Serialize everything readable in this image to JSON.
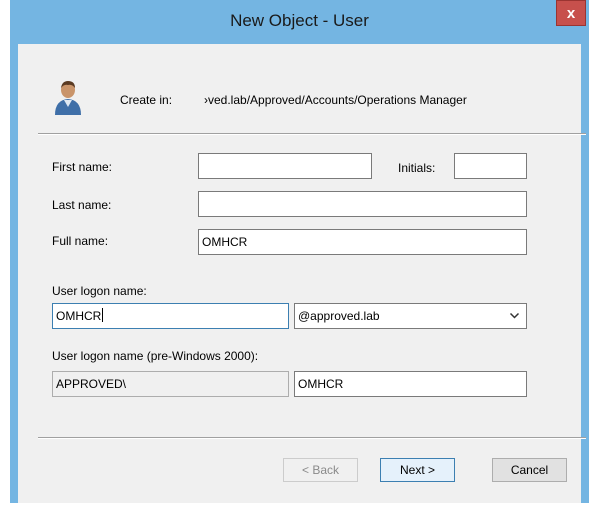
{
  "window": {
    "title": "New Object - User",
    "close_label": "x"
  },
  "create_in": {
    "label": "Create in:",
    "path": "›ved.lab/Approved/Accounts/Operations Manager",
    "icon": "user-icon"
  },
  "fields": {
    "first_name": {
      "label": "First name:",
      "value": ""
    },
    "initials": {
      "label": "Initials:",
      "value": ""
    },
    "last_name": {
      "label": "Last name:",
      "value": ""
    },
    "full_name": {
      "label": "Full name:",
      "value": "OMHCR"
    },
    "logon_name": {
      "label": "User logon name:",
      "value": "OMHCR"
    },
    "domain": {
      "selected": "@approved.lab"
    },
    "pre2000": {
      "label": "User logon name (pre-Windows 2000):",
      "domain": "APPROVED\\",
      "value": "OMHCR"
    }
  },
  "buttons": {
    "back": "< Back",
    "next": "Next >",
    "cancel": "Cancel"
  },
  "colors": {
    "titlebar": "#74b5e2",
    "close": "#c7504c",
    "client": "#f0f0f0"
  }
}
